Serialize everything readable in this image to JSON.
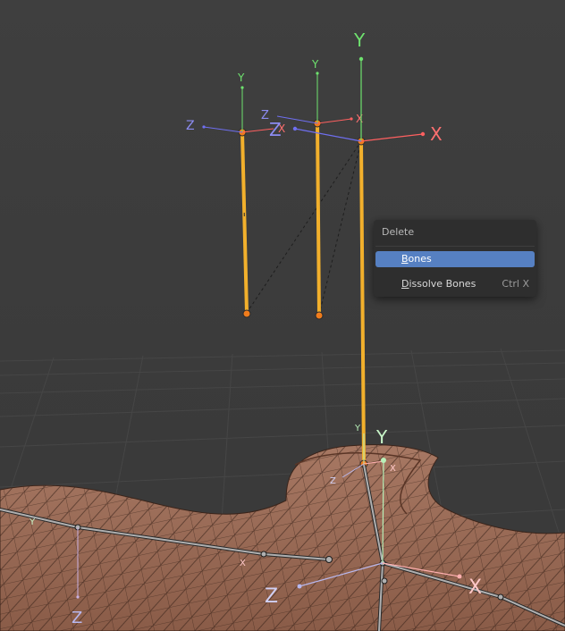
{
  "menu": {
    "title": "Delete",
    "items": [
      {
        "label": "Bones",
        "mnemonic": "B",
        "rest": "ones",
        "shortcut": "",
        "active": true
      },
      {
        "label": "Dissolve Bones",
        "mnemonic": "D",
        "rest": "issolve Bones",
        "shortcut": "Ctrl X",
        "active": false
      }
    ]
  },
  "axes": {
    "x": "X",
    "y": "Y",
    "z": "Z"
  },
  "colors": {
    "bone_selected": "#f2b02c",
    "bone_head": "#f07c1c",
    "axis_x": "#ff6060",
    "axis_y": "#6ee26e",
    "axis_z": "#6f6ff0",
    "mesh_fill": "#9a6a55",
    "menu_highlight": "#5680c2"
  }
}
